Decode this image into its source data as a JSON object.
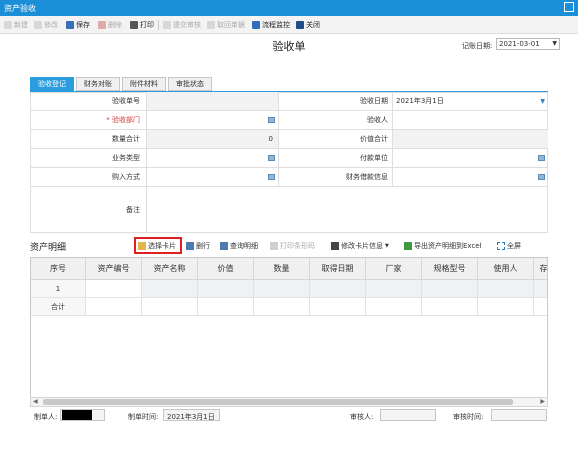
{
  "window": {
    "title": "资产验收"
  },
  "toolbar": {
    "new": "新建",
    "edit": "修改",
    "save": "保存",
    "delete": "删除",
    "print": "打印",
    "submit": "提交审核",
    "withdraw": "取回单据",
    "flow": "流程监控",
    "close": "关闭"
  },
  "header": {
    "title": "验收单",
    "record_date_label": "记账日期:",
    "record_date": "2021-03-01"
  },
  "tabs": [
    "验收登记",
    "财务对账",
    "附件材料",
    "审批状态"
  ],
  "form": {
    "receipt_no_label": "验收单号",
    "receipt_no": "",
    "receipt_date_label": "验收日期",
    "receipt_date": "2021年3月1日",
    "receipt_dept_label": "验收部门",
    "receipt_dept_mark": "*",
    "receipt_dept": "",
    "receiver_label": "验收人",
    "receiver": "",
    "qty_total_label": "数量合计",
    "qty_total": "0",
    "value_total_label": "价值合计",
    "value_total": "",
    "biz_type_label": "业务类型",
    "biz_type": "",
    "pay_unit_label": "付款单位",
    "pay_unit": "",
    "purchase_method_label": "购入方式",
    "purchase_method": "",
    "finance_borrow_label": "财务借款信息",
    "finance_borrow": "",
    "remark_label": "备注",
    "remark": ""
  },
  "detail": {
    "title": "资产明细",
    "actions": {
      "select_card": "选择卡片",
      "delete_row": "删行",
      "query_detail": "查询明细",
      "print_barcode": "打印条形码",
      "modify_card": "修改卡片信息",
      "export_excel": "导出资产明细到Excel",
      "fullscreen": "全屏"
    },
    "columns": [
      "序号",
      "资产编号",
      "资产名称",
      "价值",
      "数量",
      "取得日期",
      "厂家",
      "规格型号",
      "使用人",
      "存"
    ],
    "rows": [
      [
        "1",
        "",
        "",
        "",
        "",
        "",
        "",
        "",
        "",
        ""
      ]
    ],
    "total_label": "合计"
  },
  "footer": {
    "creator_label": "制单人:",
    "create_time_label": "制单时间:",
    "create_time": "2021年3月1日",
    "auditor_label": "审核人:",
    "audit_time_label": "审核时间:"
  },
  "colors": {
    "title_bar": "#1a8fd8",
    "tab_active": "#2b9ce0",
    "highlight_box": "#e02020"
  }
}
